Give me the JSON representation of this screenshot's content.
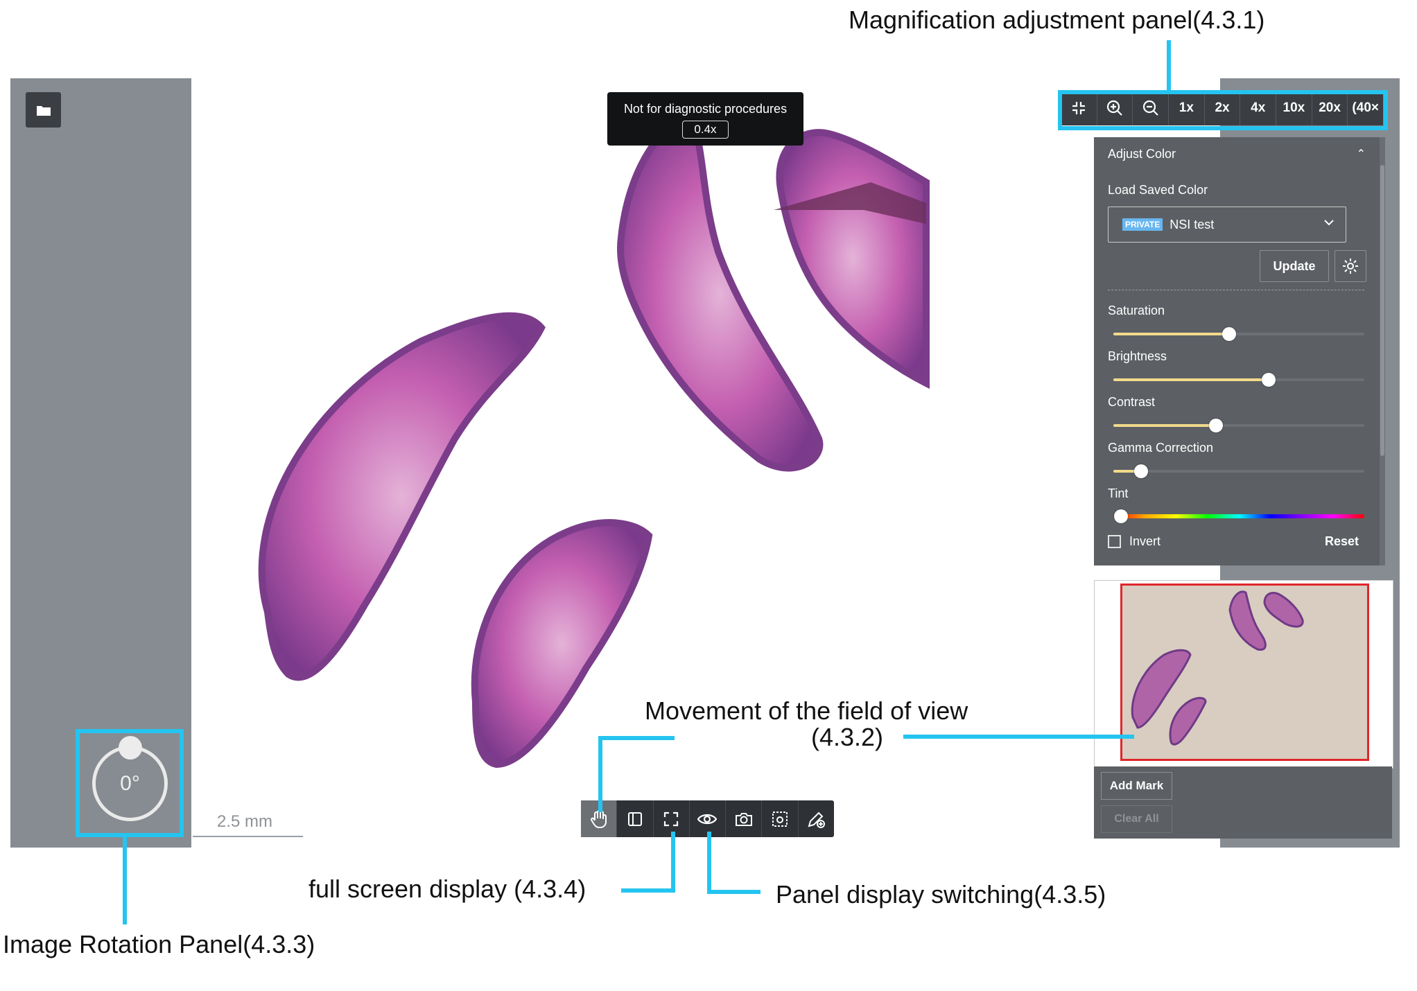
{
  "notice": {
    "text": "Not for diagnostic procedures",
    "zoom": "0.4x"
  },
  "magnification": {
    "buttons": [
      {
        "id": "fit",
        "label": "",
        "icon": "fit-screen-icon"
      },
      {
        "id": "zoom-in",
        "label": "",
        "icon": "zoom-in-icon"
      },
      {
        "id": "zoom-out",
        "label": "",
        "icon": "zoom-out-icon"
      },
      {
        "id": "1x",
        "label": "1x"
      },
      {
        "id": "2x",
        "label": "2x"
      },
      {
        "id": "4x",
        "label": "4x"
      },
      {
        "id": "10x",
        "label": "10x"
      },
      {
        "id": "20x",
        "label": "20x"
      },
      {
        "id": "40x",
        "label": "(40×"
      }
    ]
  },
  "color_panel": {
    "title": "Adjust Color",
    "load_saved_label": "Load Saved Color",
    "selected_badge": "PRIVATE",
    "selected_value": "NSI test",
    "update_label": "Update",
    "sliders": [
      {
        "id": "saturation",
        "label": "Saturation",
        "value": 0.46
      },
      {
        "id": "brightness",
        "label": "Brightness",
        "value": 0.62
      },
      {
        "id": "contrast",
        "label": "Contrast",
        "value": 0.41
      },
      {
        "id": "gamma",
        "label": "Gamma Correction",
        "value": 0.11
      }
    ],
    "tint_label": "Tint",
    "tint_value": 0.0,
    "invert_label": "Invert",
    "reset_label": "Reset"
  },
  "marks": {
    "add_label": "Add Mark",
    "clear_label": "Clear All"
  },
  "rotation": {
    "value": "0°"
  },
  "scale": {
    "label": "2.5 mm"
  },
  "toolbar": {
    "tools": [
      {
        "id": "pan",
        "icon": "hand-icon",
        "active": true
      },
      {
        "id": "panel",
        "icon": "panel-icon"
      },
      {
        "id": "fullscreen",
        "icon": "fullscreen-icon"
      },
      {
        "id": "view",
        "icon": "eye-icon"
      },
      {
        "id": "snapshot",
        "icon": "camera-icon"
      },
      {
        "id": "region",
        "icon": "region-capture-icon"
      },
      {
        "id": "annotate",
        "icon": "pen-icon"
      }
    ]
  },
  "annotations": {
    "magnification": "Magnification adjustment panel(4.3.1)",
    "movement_line1": "Movement of the field of view",
    "movement_line2": "(4.3.2)",
    "fullscreen": "full screen display (4.3.4)",
    "panel_switch": "Panel display switching(4.3.5)",
    "rotation": "Image Rotation Panel(4.3.3)"
  },
  "colors": {
    "accent": "#25c4f0",
    "panel_bg": "#5c6064",
    "strip_bg": "#868c91",
    "toolbar_bg": "#2e3236",
    "slider_fill": "#f1da8c",
    "tissue": "#c45fb0",
    "thumb_border": "#e0262b"
  }
}
